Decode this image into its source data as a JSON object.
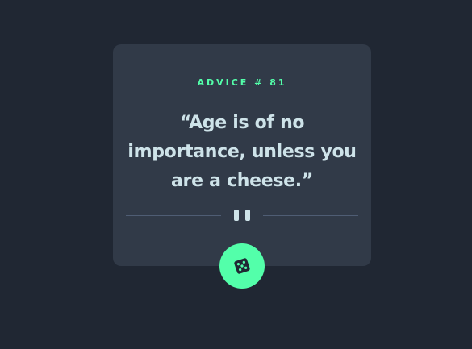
{
  "advice": {
    "label": "ADVICE # 81",
    "quote": "“Age is of no importance, unless you are a cheese.”"
  },
  "divider": {
    "icon": "pause-icon"
  },
  "dice_button": {
    "icon": "dice-icon"
  },
  "colors": {
    "background": "#202733",
    "card": "#313a48",
    "accent": "#53ffaa",
    "text": "#cee3e9",
    "divider": "#4f5d74"
  }
}
